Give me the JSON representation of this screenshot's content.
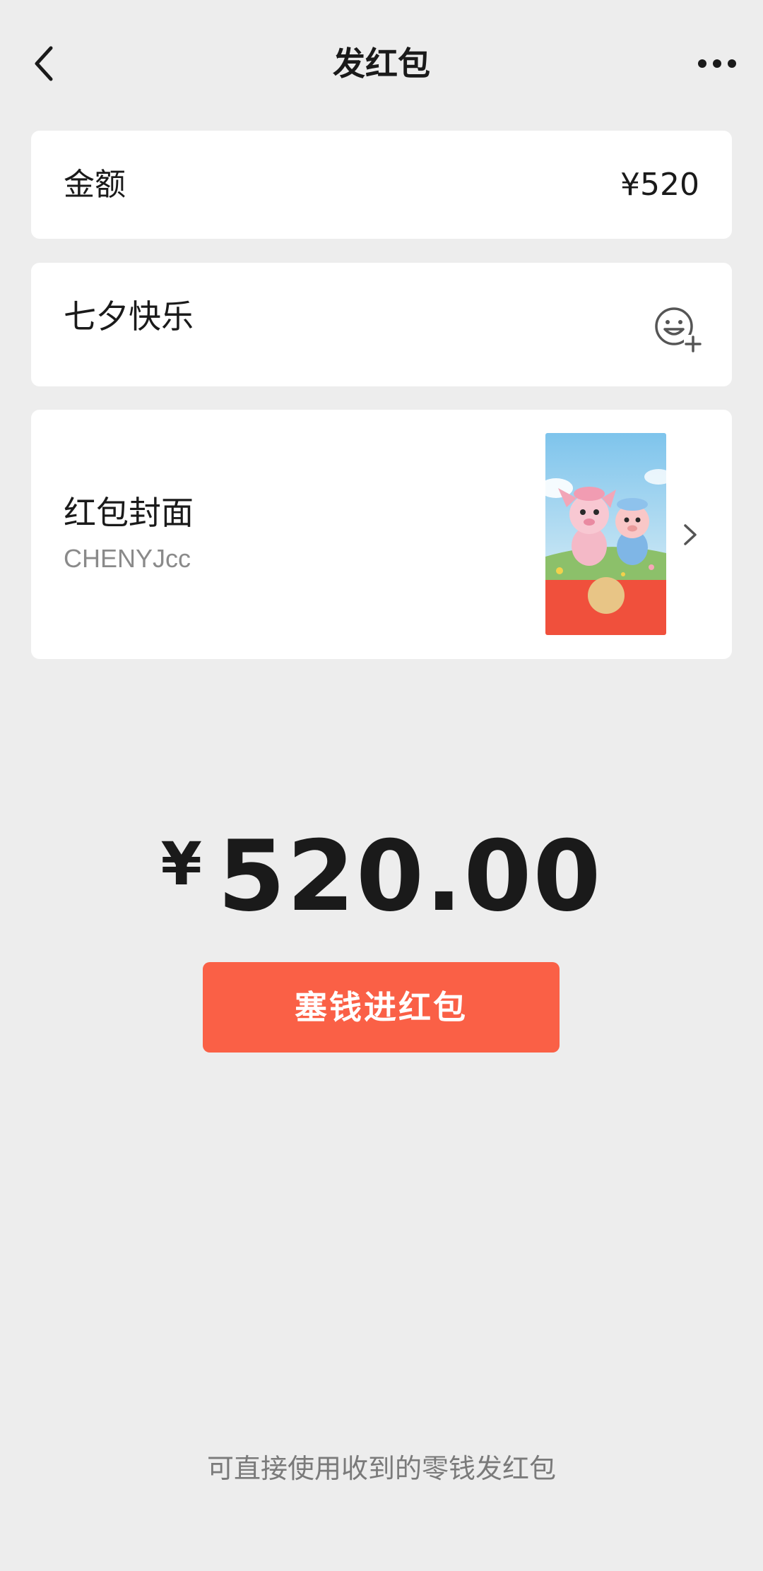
{
  "header": {
    "title": "发红包",
    "back_icon": "chevron-left-icon",
    "more_icon": "more-dots-icon"
  },
  "amount_row": {
    "label": "金额",
    "value": "¥520"
  },
  "greeting_row": {
    "text": "七夕快乐",
    "emoji_icon": "emoji-add-icon"
  },
  "cover_row": {
    "label": "红包封面",
    "author": "CHENYJcc",
    "chevron_icon": "chevron-right-icon"
  },
  "total": {
    "currency": "¥",
    "amount": "520.00"
  },
  "primary_button": {
    "label": "塞钱进红包",
    "color": "#fa6046"
  },
  "footer": {
    "hint": "可直接使用收到的零钱发红包"
  },
  "colors": {
    "background": "#ededed",
    "card": "#ffffff",
    "accent": "#fa6046",
    "envelope_red": "#f0503c"
  }
}
